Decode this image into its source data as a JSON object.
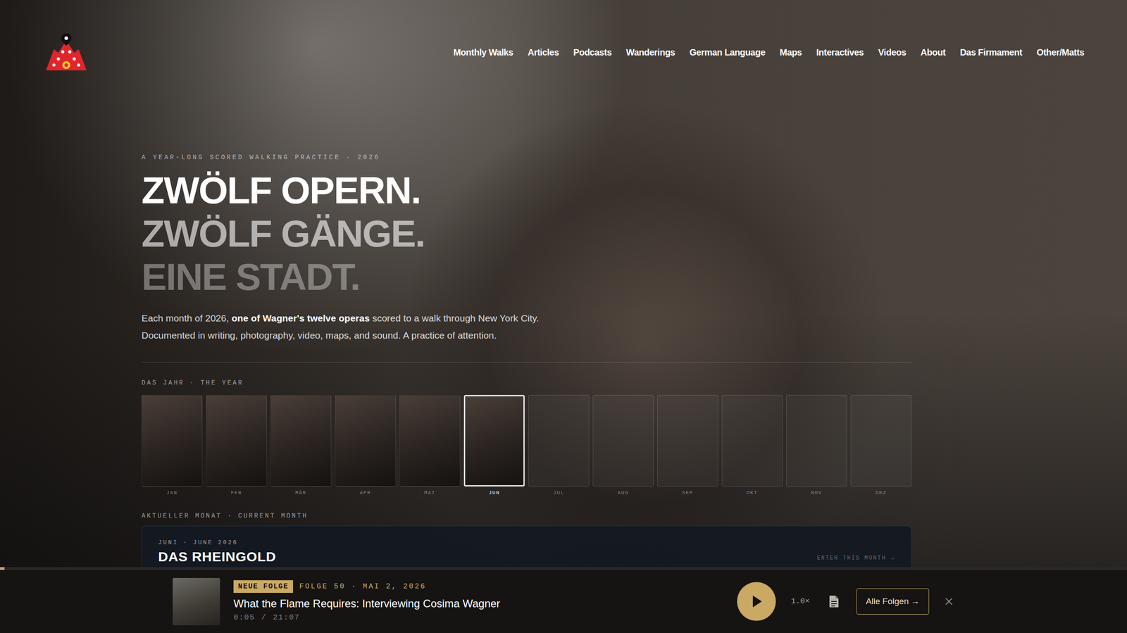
{
  "nav": [
    {
      "label": "Monthly Walks"
    },
    {
      "label": "Articles"
    },
    {
      "label": "Podcasts"
    },
    {
      "label": "Wanderings"
    },
    {
      "label": "German Language"
    },
    {
      "label": "Maps"
    },
    {
      "label": "Interactives"
    },
    {
      "label": "Videos"
    },
    {
      "label": "About"
    },
    {
      "label": "Das Firmament"
    },
    {
      "label": "Other/Matts"
    }
  ],
  "hero": {
    "eyebrow": "A YEAR-LONG SCORED WALKING PRACTICE · 2026",
    "lines": [
      {
        "text": "ZWÖLF OPERN.",
        "kind": "bright"
      },
      {
        "text": "ZWÖLF GÄNGE.",
        "kind": "mid"
      },
      {
        "text": "EINE STADT.",
        "kind": "dim"
      }
    ],
    "intro": [
      {
        "text": "Each month of 2026, ",
        "emphasis": false
      },
      {
        "text": "one of Wagner's twelve operas",
        "emphasis": true
      },
      {
        "text": " scored to a walk through New York City. Documented in writing, photography, video, maps, and sound. A practice of attention.",
        "emphasis": false
      }
    ]
  },
  "year": {
    "label": "DAS JAHR · THE YEAR",
    "months": [
      {
        "label": "JAN",
        "kind": "photo",
        "selected": false
      },
      {
        "label": "FEB",
        "kind": "photo",
        "selected": false
      },
      {
        "label": "MÄR",
        "kind": "photo",
        "selected": false
      },
      {
        "label": "APR",
        "kind": "photo",
        "selected": false
      },
      {
        "label": "MAI",
        "kind": "photo",
        "selected": false
      },
      {
        "label": "JUN",
        "kind": "photo",
        "selected": true
      },
      {
        "label": "JUL",
        "kind": "empty",
        "selected": false
      },
      {
        "label": "AUG",
        "kind": "empty",
        "selected": false
      },
      {
        "label": "SEP",
        "kind": "empty",
        "selected": false
      },
      {
        "label": "OKT",
        "kind": "empty",
        "selected": false
      },
      {
        "label": "NOV",
        "kind": "empty",
        "selected": false
      },
      {
        "label": "DEZ",
        "kind": "empty",
        "selected": false
      }
    ]
  },
  "current": {
    "label": "AKTUELLER MONAT · CURRENT MONTH",
    "eyebrow": "JUNI · JUNE 2026",
    "title": "DAS RHEINGOLD",
    "link": "ENTER THIS MONTH →"
  },
  "player": {
    "progress": {
      "level": 0.004
    },
    "badge": "NEUE FOLGE",
    "meta": "FOLGE 50 · MAI 2, 2026",
    "title": "What the Flame Requires: Interviewing Cosima Wagner",
    "elapsed": "0:05",
    "separator": "/",
    "duration": "21:07",
    "playing": false,
    "speed": "1.0×",
    "all_episodes": "Alle Folgen →"
  }
}
